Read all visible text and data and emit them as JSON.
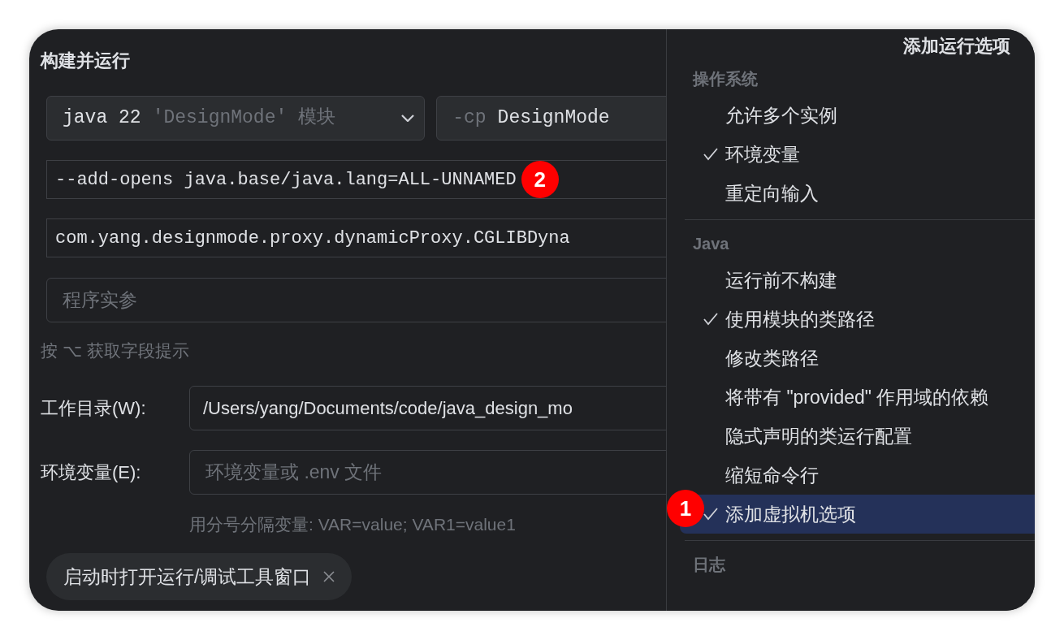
{
  "title": "构建并运行",
  "jre": {
    "value": "java 22",
    "hint": "'DesignMode' 模块"
  },
  "classpath": {
    "prefix": "-cp",
    "value": "DesignMode"
  },
  "vm_options": {
    "value": "--add-opens java.base/java.lang=ALL-UNNAMED",
    "callout": "2"
  },
  "main_class": {
    "value": "com.yang.designmode.proxy.dynamicProxy.CGLIBDyna"
  },
  "program_args": {
    "placeholder": "程序实参"
  },
  "field_hint": "按 ⌥ 获取字段提示",
  "working_dir": {
    "label": "工作目录(W):",
    "value": "/Users/yang/Documents/code/java_design_mo"
  },
  "env": {
    "label": "环境变量(E):",
    "placeholder": "环境变量或 .env 文件",
    "hint": "用分号分隔变量: VAR=value; VAR1=value1"
  },
  "tags": [
    {
      "label": "启动时打开运行/调试工具窗口"
    }
  ],
  "popup": {
    "title": "添加运行选项",
    "groups": [
      {
        "header": "操作系统",
        "items": [
          {
            "label": "允许多个实例",
            "checked": false,
            "selected": false
          },
          {
            "label": "环境变量",
            "checked": true,
            "selected": false
          },
          {
            "label": "重定向输入",
            "checked": false,
            "selected": false
          }
        ]
      },
      {
        "header": "Java",
        "items": [
          {
            "label": "运行前不构建",
            "checked": false,
            "selected": false
          },
          {
            "label": "使用模块的类路径",
            "checked": true,
            "selected": false
          },
          {
            "label": "修改类路径",
            "checked": false,
            "selected": false
          },
          {
            "label": "将带有 \"provided\" 作用域的依赖",
            "checked": false,
            "selected": false
          },
          {
            "label": "隐式声明的类运行配置",
            "checked": false,
            "selected": false
          },
          {
            "label": "缩短命令行",
            "checked": false,
            "selected": false
          },
          {
            "label": "添加虚拟机选项",
            "checked": true,
            "selected": true,
            "callout": "1"
          }
        ]
      },
      {
        "header": "日志"
      }
    ]
  }
}
